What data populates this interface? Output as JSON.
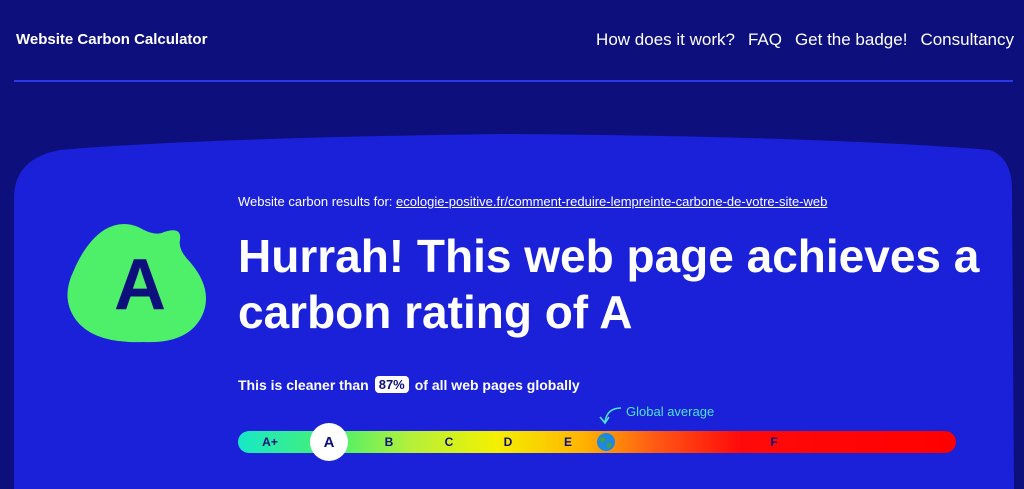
{
  "header": {
    "brand": "Website Carbon Calculator",
    "nav": [
      "How does it work?",
      "FAQ",
      "Get the badge!",
      "Consultancy"
    ]
  },
  "result": {
    "prefix": "Website carbon results for:",
    "url": "ecologie-positive.fr/comment-reduire-lempreinte-carbone-de-votre-site-web",
    "headline": "Hurrah! This web page achieves a carbon rating of A",
    "grade": "A",
    "cleaner_before": "This is cleaner than",
    "cleaner_pct": "87%",
    "cleaner_after": "of all web pages globally"
  },
  "scale": {
    "labels": [
      "A+",
      "A",
      "B",
      "C",
      "D",
      "E",
      "F"
    ],
    "current": "A",
    "global_average_label": "Global average"
  },
  "colors": {
    "background": "#0c0f7c",
    "panel": "#1a21d9",
    "grade_blob": "#4ef06a",
    "accent": "#4fe2d9"
  }
}
